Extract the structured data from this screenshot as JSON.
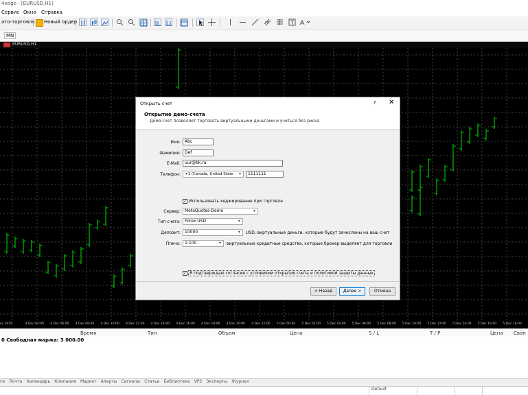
{
  "window": {
    "title": "4edge - [EURUSD,H1]"
  },
  "menu": [
    "Сервис",
    "Окно",
    "Справка"
  ],
  "toolbar": {
    "autotrade": "ато-торговля",
    "new_order": "Новый ордер"
  },
  "timeframe": {
    "current": "MN"
  },
  "chart": {
    "tab_label": "EURUSD,H1",
    "bull_color": "#00c000",
    "time_labels": [
      "ec 2019",
      "4 Dec 04:00",
      "4 Dec 06:00",
      "4 Dec 08:00",
      "4 Dec 10:00",
      "4 Dec 12:00",
      "4 Dec 14:00",
      "4 Dec 16:00",
      "4 Dec 18:00",
      "4 Dec 20:00",
      "4 Dec 22:00",
      "5 Dec 00:00",
      "5 Dec 02:00",
      "5 Dec 04:00",
      "5 Dec 06:00",
      "5 Dec 08:00",
      "5 Dec 10:00",
      "5 Dec 12:00",
      "5 Dec 14:00",
      "5 Dec 16:00",
      "5 Dec 18:00"
    ]
  },
  "terminal": {
    "columns": [
      "Время",
      "Тип",
      "Объем",
      "Цена",
      "S / L",
      "T / P",
      "Цена",
      "Своп"
    ],
    "margin_row": "0 Свободная маржа: 3 000.00",
    "tabs": [
      "ги",
      "Почта",
      "Календарь",
      "Компания",
      "Маркет",
      "Алерты",
      "Сигналы",
      "Статьи",
      "Библиотека",
      "VPS",
      "Эксперты",
      "Журнал"
    ]
  },
  "statusbar": {
    "profile": "Default"
  },
  "dialog": {
    "title": "Открыть счет",
    "help": "?",
    "close": "✕",
    "heading": "Открытие демо-счета",
    "subheading": "Демо-счет позволяет торговать виртуальными деньгами и учиться без риска",
    "name_label": "Имя:",
    "name_value": "Abc",
    "surname_label": "Фамилия:",
    "surname_value": "Def",
    "email_label": "E-Mail:",
    "email_value": "uur@bk.ru",
    "phone_label": "Телефон:",
    "phone_code": "+1 (Canada, United State",
    "phone_value": "1111111",
    "hedging_label": "Использовать хеджирование при торговле",
    "hedging_checked": "✓",
    "server_label": "Сервер:",
    "server_value": "MetaQuotes-Demo",
    "account_type_label": "Тип счета:",
    "account_type_value": "Forex USD",
    "deposit_label": "Депозит:",
    "deposit_value": "10000",
    "deposit_note": "USD, виртуальные деньги, которые будут зачислены на ваш счет",
    "leverage_label": "Плечо:",
    "leverage_value": "1:100",
    "leverage_note": "виртуальные кредитные средства, которые брокер выделяет для торговли",
    "agree_label": "Я подтверждаю согласие с условиями открытия счета и политикой защиты данных",
    "agree_checked": "✓",
    "back_button": "< Назад",
    "next_button": "Далее >",
    "cancel_button": "Отмена"
  }
}
